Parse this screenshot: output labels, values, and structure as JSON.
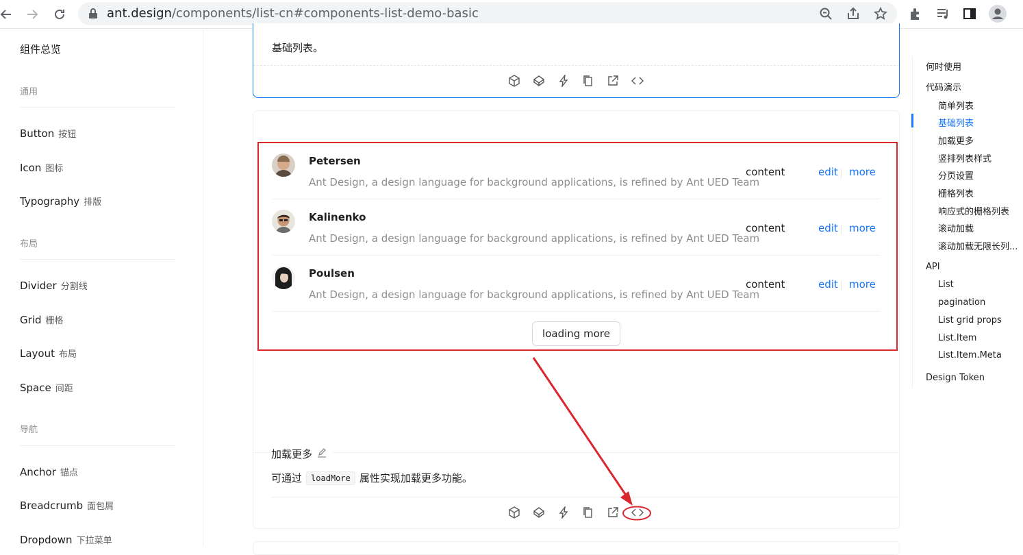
{
  "browser": {
    "url_host": "ant.design",
    "url_path": "/components/list-cn#components-list-demo-basic"
  },
  "sidebar": {
    "overview": "组件总览",
    "groups": [
      {
        "label": "通用"
      },
      {
        "label": "布局"
      },
      {
        "label": "导航"
      }
    ],
    "items": [
      {
        "en": "Button",
        "zh": "按钮"
      },
      {
        "en": "Icon",
        "zh": "图标"
      },
      {
        "en": "Typography",
        "zh": "排版"
      },
      {
        "en": "Divider",
        "zh": "分割线"
      },
      {
        "en": "Grid",
        "zh": "栅格"
      },
      {
        "en": "Layout",
        "zh": "布局"
      },
      {
        "en": "Space",
        "zh": "间距"
      },
      {
        "en": "Anchor",
        "zh": "锚点"
      },
      {
        "en": "Breadcrumb",
        "zh": "面包屑"
      },
      {
        "en": "Dropdown",
        "zh": "下拉菜单"
      }
    ]
  },
  "top_demo": {
    "description": "基础列表。"
  },
  "list_demo": {
    "items": [
      {
        "title": "Petersen",
        "description": "Ant Design, a design language for background applications, is refined by Ant UED Team",
        "content": "content",
        "edit": "edit",
        "more": "more"
      },
      {
        "title": "Kalinenko",
        "description": "Ant Design, a design language for background applications, is refined by Ant UED Team",
        "content": "content",
        "edit": "edit",
        "more": "more"
      },
      {
        "title": "Poulsen",
        "description": "Ant Design, a design language for background applications, is refined by Ant UED Team",
        "content": "content",
        "edit": "edit",
        "more": "more"
      }
    ],
    "load_more_label": "loading more",
    "meta_title": "加载更多",
    "meta_desc_before": "可通过",
    "meta_desc_code": "loadMore",
    "meta_desc_after": "属性实现加载更多功能。"
  },
  "anchors": [
    {
      "label": "何时使用",
      "level": 1
    },
    {
      "label": "代码演示",
      "level": 1
    },
    {
      "label": "简单列表",
      "level": 2
    },
    {
      "label": "基础列表",
      "level": 2,
      "active": true
    },
    {
      "label": "加载更多",
      "level": 2
    },
    {
      "label": "竖排列表样式",
      "level": 2
    },
    {
      "label": "分页设置",
      "level": 2
    },
    {
      "label": "栅格列表",
      "level": 2
    },
    {
      "label": "响应式的栅格列表",
      "level": 2
    },
    {
      "label": "滚动加载",
      "level": 2
    },
    {
      "label": "滚动加载无限长列...",
      "level": 2
    },
    {
      "label": "API",
      "level": 1
    },
    {
      "label": "List",
      "level": 2
    },
    {
      "label": "pagination",
      "level": 2
    },
    {
      "label": "List grid props",
      "level": 2
    },
    {
      "label": "List.Item",
      "level": 2
    },
    {
      "label": "List.Item.Meta",
      "level": 2
    },
    {
      "label": "Design Token",
      "level": 1
    }
  ],
  "colors": {
    "accent": "#1677ff",
    "annotation": "#d9272e"
  }
}
